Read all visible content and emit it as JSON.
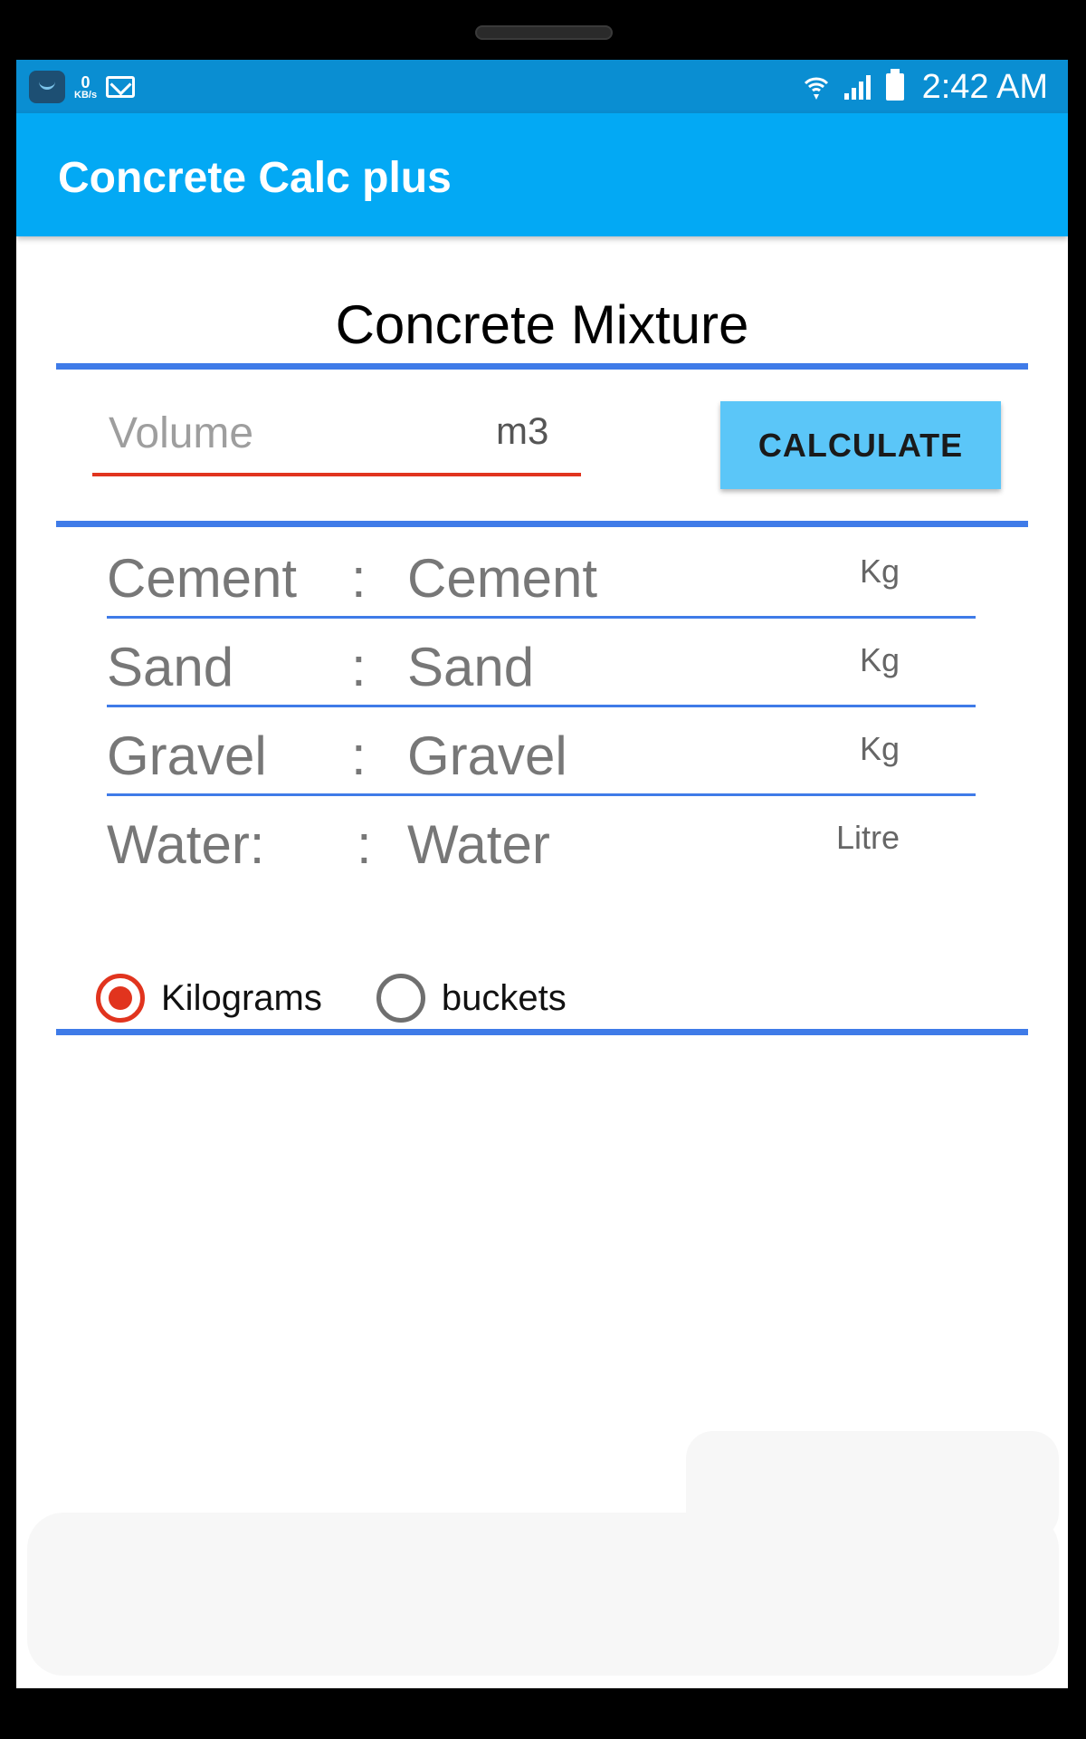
{
  "status_bar": {
    "net_speed_value": "0",
    "net_speed_unit": "KB/s",
    "time": "2:42 AM",
    "icons": [
      "shopping-bag-icon",
      "mail-icon",
      "wifi-icon",
      "signal-icon",
      "battery-icon"
    ]
  },
  "app_bar": {
    "title": "Concrete Calc plus"
  },
  "main": {
    "title": "Concrete Mixture",
    "volume": {
      "placeholder": "Volume",
      "value": "",
      "unit": "m3"
    },
    "calculate_label": "CALCULATE",
    "results": [
      {
        "label": "Cement",
        "colon": ":",
        "value": "Cement",
        "unit": "Kg"
      },
      {
        "label": "Sand",
        "colon": ":",
        "value": "Sand",
        "unit": "Kg"
      },
      {
        "label": "Gravel",
        "colon": ":",
        "value": "Gravel",
        "unit": "Kg"
      },
      {
        "label": "Water:",
        "colon": ":",
        "value": "Water",
        "unit": "Litre"
      }
    ],
    "unit_options": [
      {
        "label": "Kilograms",
        "selected": true
      },
      {
        "label": "buckets",
        "selected": false
      }
    ]
  },
  "colors": {
    "status_bar": "#0a8ed2",
    "app_bar": "#03a9f4",
    "accent_line": "#3f7be8",
    "input_underline": "#e1341e",
    "button": "#5bc6f8",
    "radio_selected": "#e1341e"
  }
}
